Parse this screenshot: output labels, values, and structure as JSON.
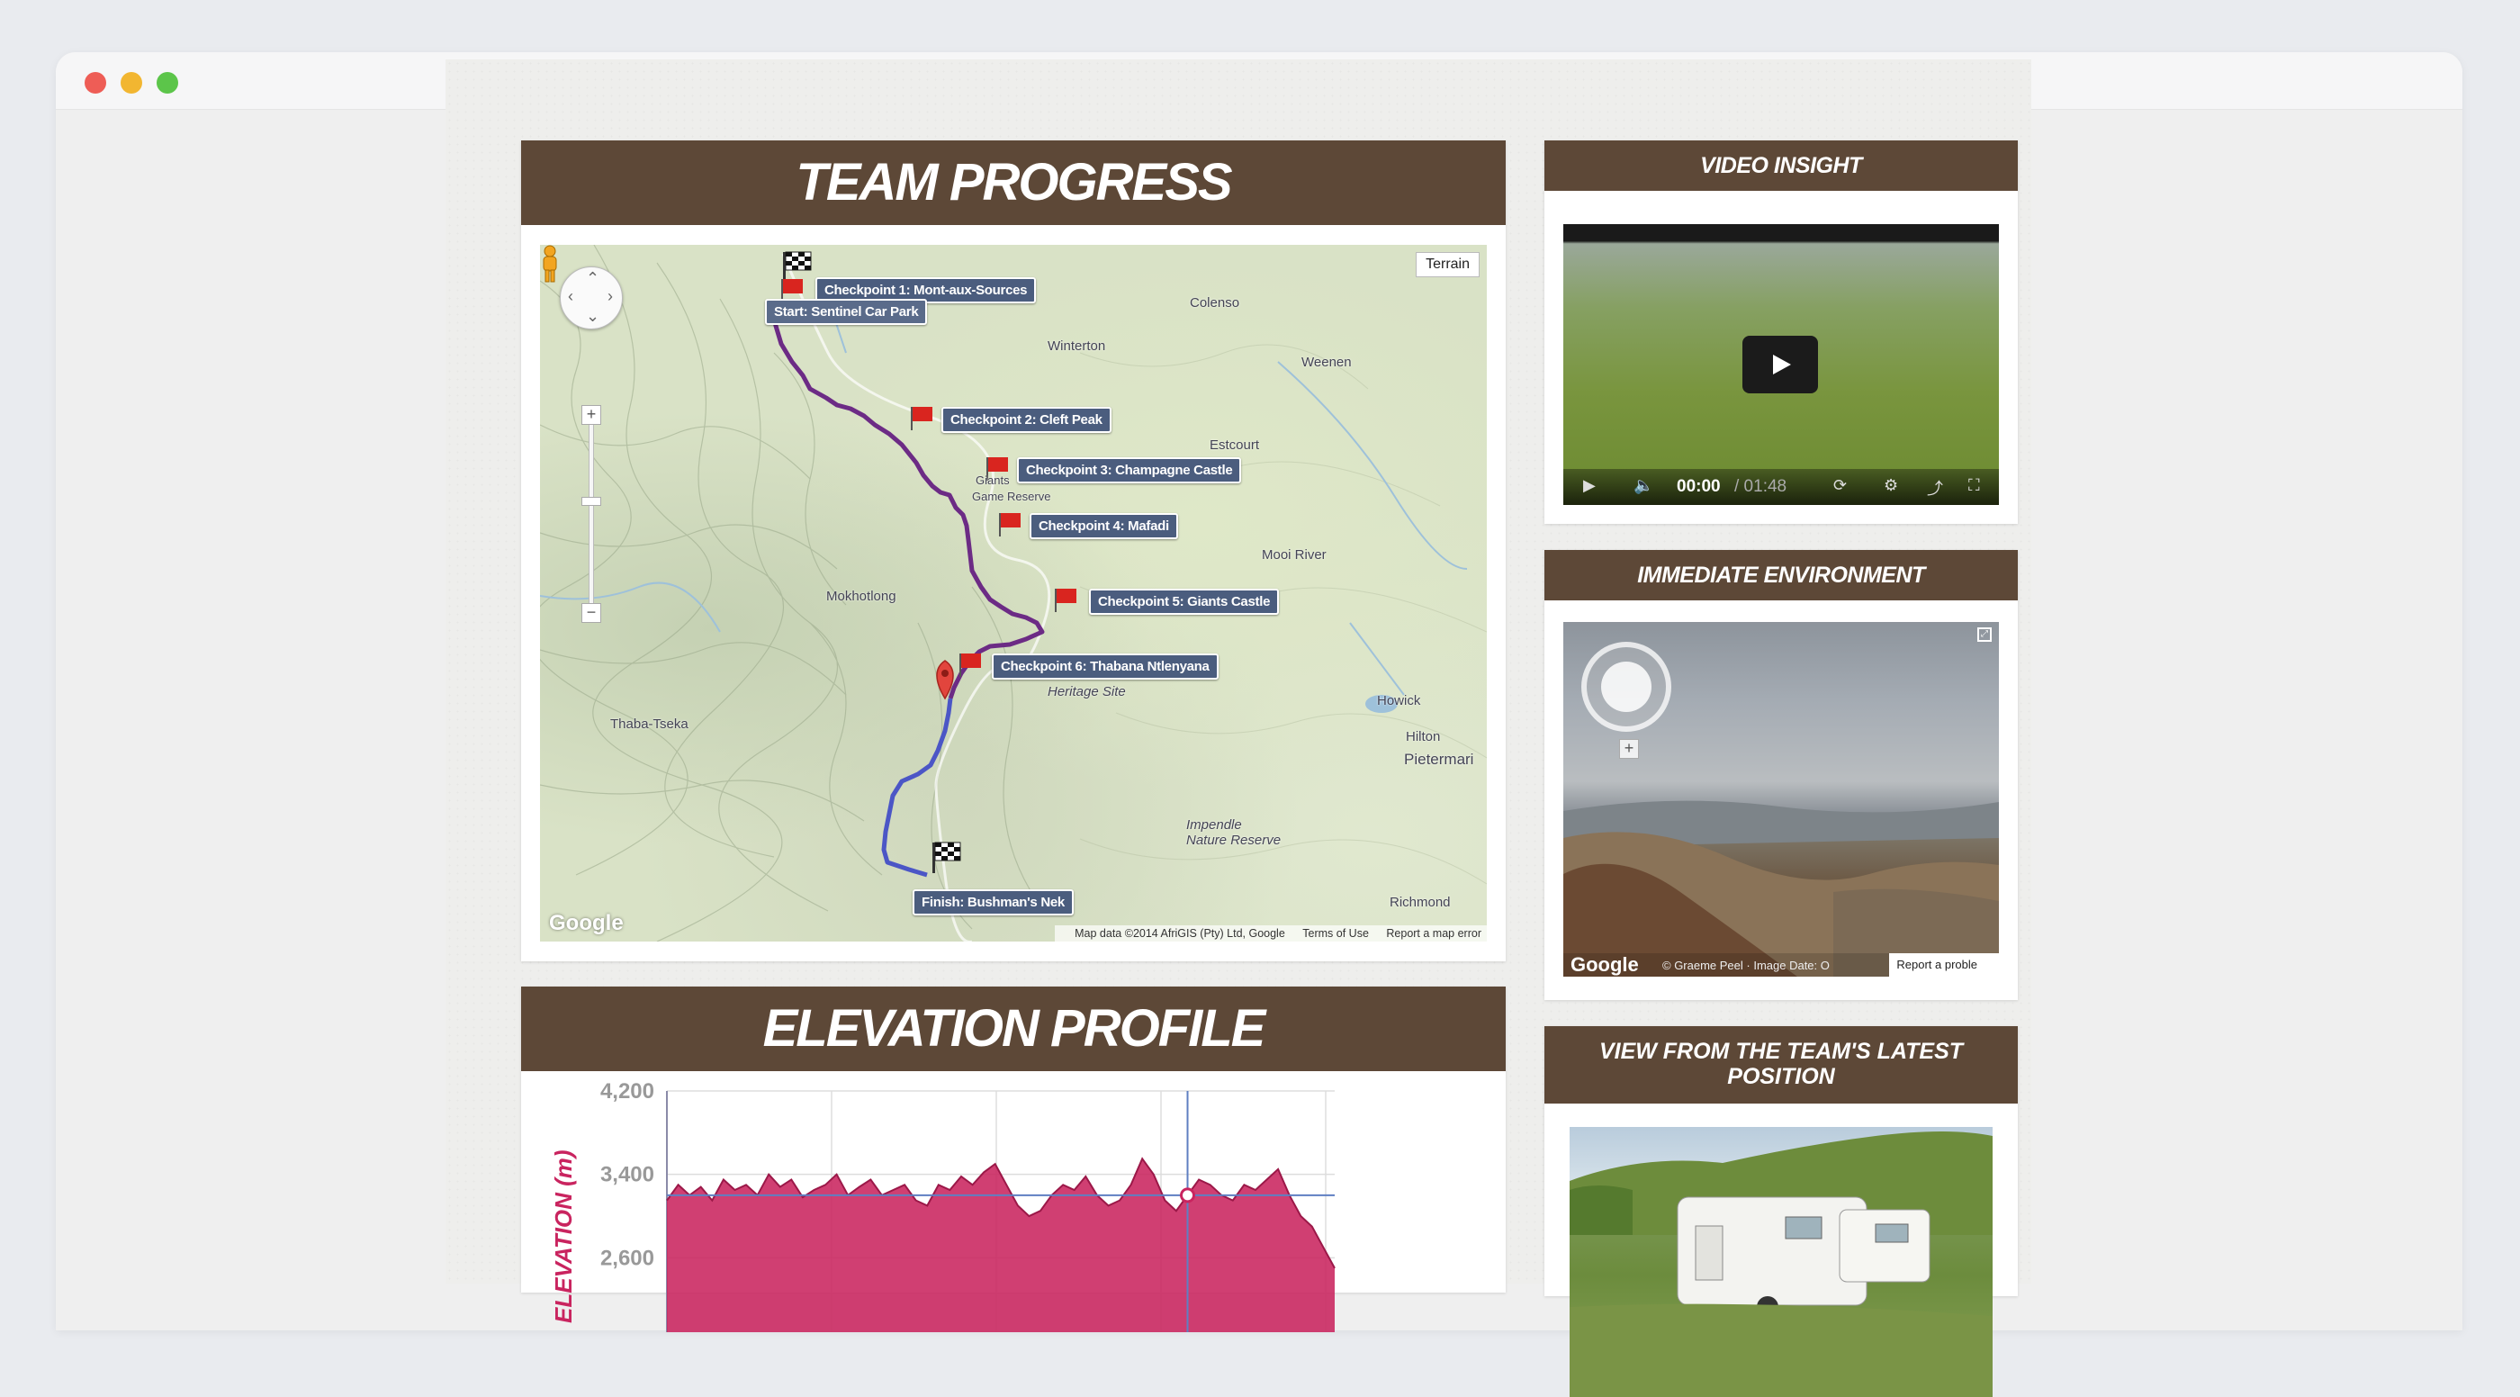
{
  "panels": {
    "team_progress": "TEAM PROGRESS",
    "elevation_profile": "ELEVATION PROFILE",
    "video_insight": "VIDEO INSIGHT",
    "immediate_environment": "IMMEDIATE ENVIRONMENT",
    "latest_view": "VIEW FROM THE TEAM'S LATEST POSITION"
  },
  "map": {
    "terrain_button": "Terrain",
    "checkpoints": [
      "Start: Sentinel Car Park",
      "Checkpoint 1: Mont-aux-Sources",
      "Checkpoint 2: Cleft Peak",
      "Checkpoint 3: Champagne Castle",
      "Checkpoint 4: Mafadi",
      "Checkpoint 5: Giants Castle",
      "Checkpoint 6: Thabana Ntlenyana",
      "Finish: Bushman's Nek"
    ],
    "places": [
      "Colenso",
      "Winterton",
      "Weenen",
      "Estcourt",
      "Mooi River",
      "Mokhotlong",
      "Thaba-Tseka",
      "Howick",
      "Hilton",
      "Pietermari",
      "Richmond",
      "Heritage Site",
      "Impendle Nature Reserve",
      "Giants",
      "Game Reserve"
    ],
    "footer": {
      "data": "Map data ©2014 AfriGIS (Pty) Ltd, Google",
      "terms": "Terms of Use",
      "report": "Report a map error"
    },
    "logo": "Google"
  },
  "video": {
    "time_current": "00:00",
    "time_total": "/ 01:48"
  },
  "street_view": {
    "footer_left": "© Graeme Peel · Image Date: O",
    "report": "Report a proble",
    "logo": "Google"
  },
  "chart_data": {
    "type": "area",
    "ylabel": "ELEVATION (m)",
    "y_ticks": [
      "4,200",
      "3,400",
      "2,600"
    ],
    "color": "#c9245f",
    "values": [
      3150,
      3300,
      3200,
      3280,
      3150,
      3350,
      3250,
      3300,
      3200,
      3400,
      3280,
      3350,
      3180,
      3250,
      3300,
      3400,
      3200,
      3280,
      3350,
      3200,
      3250,
      3300,
      3150,
      3100,
      3300,
      3250,
      3380,
      3300,
      3420,
      3500,
      3300,
      3100,
      3000,
      3050,
      3200,
      3300,
      3250,
      3380,
      3200,
      3100,
      3150,
      3300,
      3550,
      3400,
      3150,
      3050,
      3200,
      3350,
      3300,
      3200,
      3150,
      3300,
      3250,
      3350,
      3450,
      3200,
      3000,
      2900,
      2700,
      2500
    ]
  }
}
